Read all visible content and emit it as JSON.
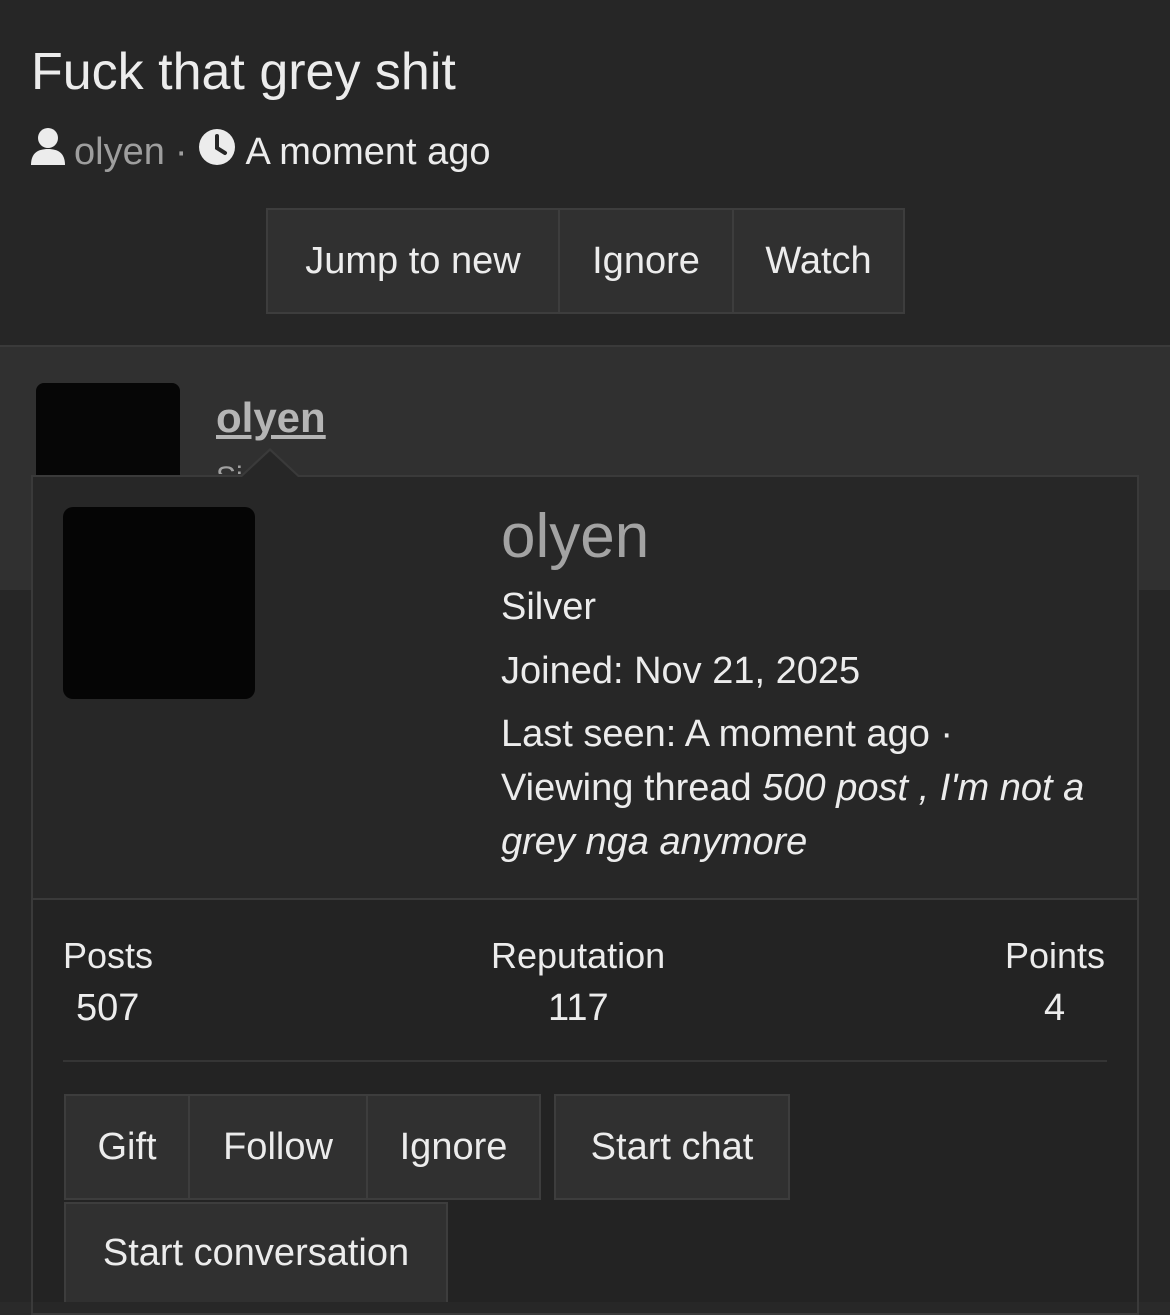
{
  "thread": {
    "title": "Fuck that grey shit",
    "author": "olyen",
    "separator": "·",
    "time": "A moment ago",
    "buttons": {
      "jump": "Jump to new",
      "ignore": "Ignore",
      "watch": "Watch"
    }
  },
  "post": {
    "username": "olyen",
    "rank_partial": "Si"
  },
  "popup": {
    "name": "olyen",
    "rank": "Silver",
    "joined": "Joined: Nov 21, 2025",
    "last_seen": "Last seen: A moment ago ·",
    "viewing_prefix": "Viewing thread ",
    "viewing_thread_line1": "500 post , I'm not a",
    "viewing_thread_line2": "grey nga anymore",
    "stats": {
      "posts_label": "Posts",
      "posts_value": "507",
      "reputation_label": "Reputation",
      "reputation_value": "117",
      "points_label": "Points",
      "points_value": "4"
    },
    "actions": {
      "gift": "Gift",
      "follow": "Follow",
      "ignore": "Ignore",
      "start_chat": "Start chat",
      "start_conversation": "Start conversation"
    }
  },
  "icons": {
    "author": "user-icon",
    "time": "clock-icon"
  },
  "colors": {
    "background": "#262626",
    "panel": "#303030",
    "muted_text": "#9e9e9e",
    "text": "#ececec"
  }
}
